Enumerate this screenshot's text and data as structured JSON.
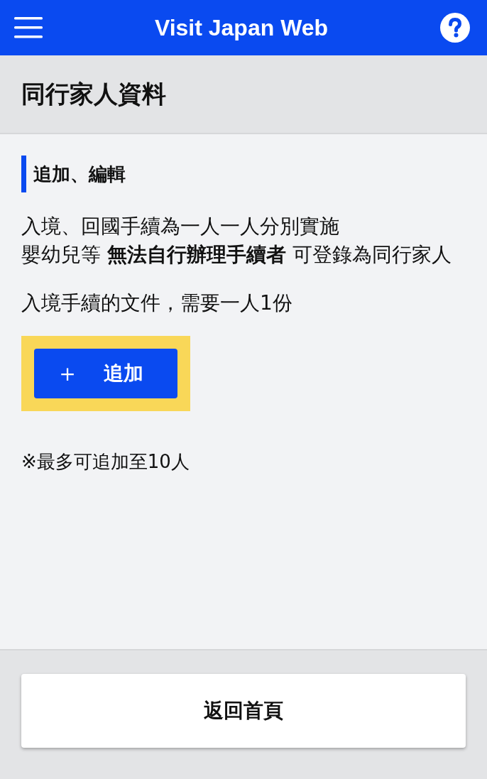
{
  "header": {
    "title": "Visit Japan Web"
  },
  "page_title": "同行家人資料",
  "section": {
    "heading": "追加、編輯",
    "paragraphs": [
      {
        "lines": [
          "入境、回國手續為一人一人分別實施",
          "嬰幼兒等 **無法自行辦理手續者** 可登錄為同行家人"
        ]
      },
      {
        "lines": [
          "入境手續的文件，需要一人1份"
        ]
      }
    ],
    "add_button": {
      "icon": "＋",
      "label": "追加",
      "highlighted": true
    },
    "note": "※最多可追加至10人"
  },
  "footer": {
    "button": "返回首頁"
  }
}
